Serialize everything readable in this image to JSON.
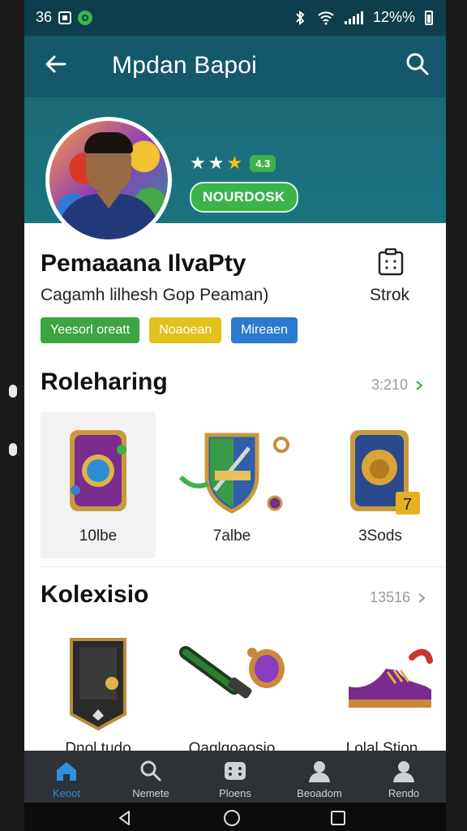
{
  "status_bar": {
    "time": "36",
    "battery_text": "12%%"
  },
  "app_bar": {
    "title": "Mpdan Bapoi"
  },
  "profile": {
    "rating_badge": "4.3",
    "status_pill": "NOURDOSK",
    "name": "Pemaaana IlvaPty",
    "subtitle": "Cagamh lilhesh Gop Peaman)",
    "stock_label": "Strok",
    "tags": [
      "Yeesorl oreatt",
      "Noaoean",
      "Mireaen"
    ]
  },
  "section_1": {
    "title": "Roleharing",
    "count": "3:210",
    "items": [
      {
        "label": "10lbe",
        "icon": "purple-shield-badge-icon"
      },
      {
        "label": "7albe",
        "icon": "crest-shield-icon"
      },
      {
        "label": "3Sods",
        "icon": "lion-shield-icon"
      }
    ]
  },
  "section_2": {
    "title": "Kolexisio",
    "count": "13516",
    "items": [
      {
        "label": "Dnol tudo",
        "icon": "dark-card-icon"
      },
      {
        "label": "Oaglgoaosio",
        "icon": "scroll-amulet-icon"
      },
      {
        "label": "Lolal Stion",
        "icon": "purple-shoe-icon"
      }
    ]
  },
  "bottom_nav": [
    {
      "label": "Keoot",
      "icon": "home-icon",
      "active": true
    },
    {
      "label": "Nemete",
      "icon": "search-icon",
      "active": false
    },
    {
      "label": "Ploens",
      "icon": "dice-icon",
      "active": false
    },
    {
      "label": "Beoadom",
      "icon": "person-icon",
      "active": false
    },
    {
      "label": "Rendo",
      "icon": "profile-icon",
      "active": false
    }
  ],
  "colors": {
    "status_bar": "#0e3d4d",
    "app_bar": "#15586b",
    "banner": "#1a7480",
    "accent_green": "#3bb34a",
    "accent_yellow": "#e3c11d",
    "accent_blue": "#2a7ad1",
    "nav_active": "#2f8fe0"
  }
}
